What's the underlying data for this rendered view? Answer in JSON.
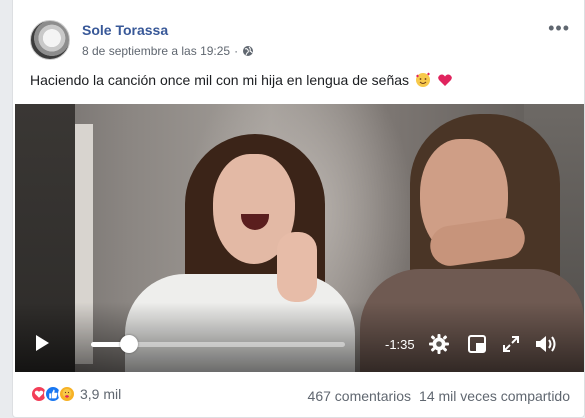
{
  "post": {
    "author": "Sole Torassa",
    "timestamp": "8 de septiembre a las 19:25",
    "privacy_icon": "globe-icon",
    "more_label": "•••",
    "text": "Haciendo la canción once mil con mi hija en lengua de señas",
    "emojis": [
      "smiling-face-with-hearts-emoji",
      "red-heart-emoji"
    ]
  },
  "video": {
    "remaining_time": "-1:35",
    "progress": 0.15,
    "controls": [
      "play-icon",
      "settings-gear-icon",
      "picture-in-picture-icon",
      "fullscreen-icon",
      "volume-icon"
    ]
  },
  "footer": {
    "reaction_icons": [
      "love-reaction-icon",
      "like-reaction-icon",
      "care-reaction-icon"
    ],
    "reaction_count": "3,9 mil",
    "comments": "467 comentarios",
    "shares": "14 mil veces compartido"
  },
  "colors": {
    "author_link": "#385898",
    "secondary_text": "#606770",
    "like_blue": "#1877f2",
    "love_red": "#f33e58",
    "care_yellow": "#f7b125"
  }
}
